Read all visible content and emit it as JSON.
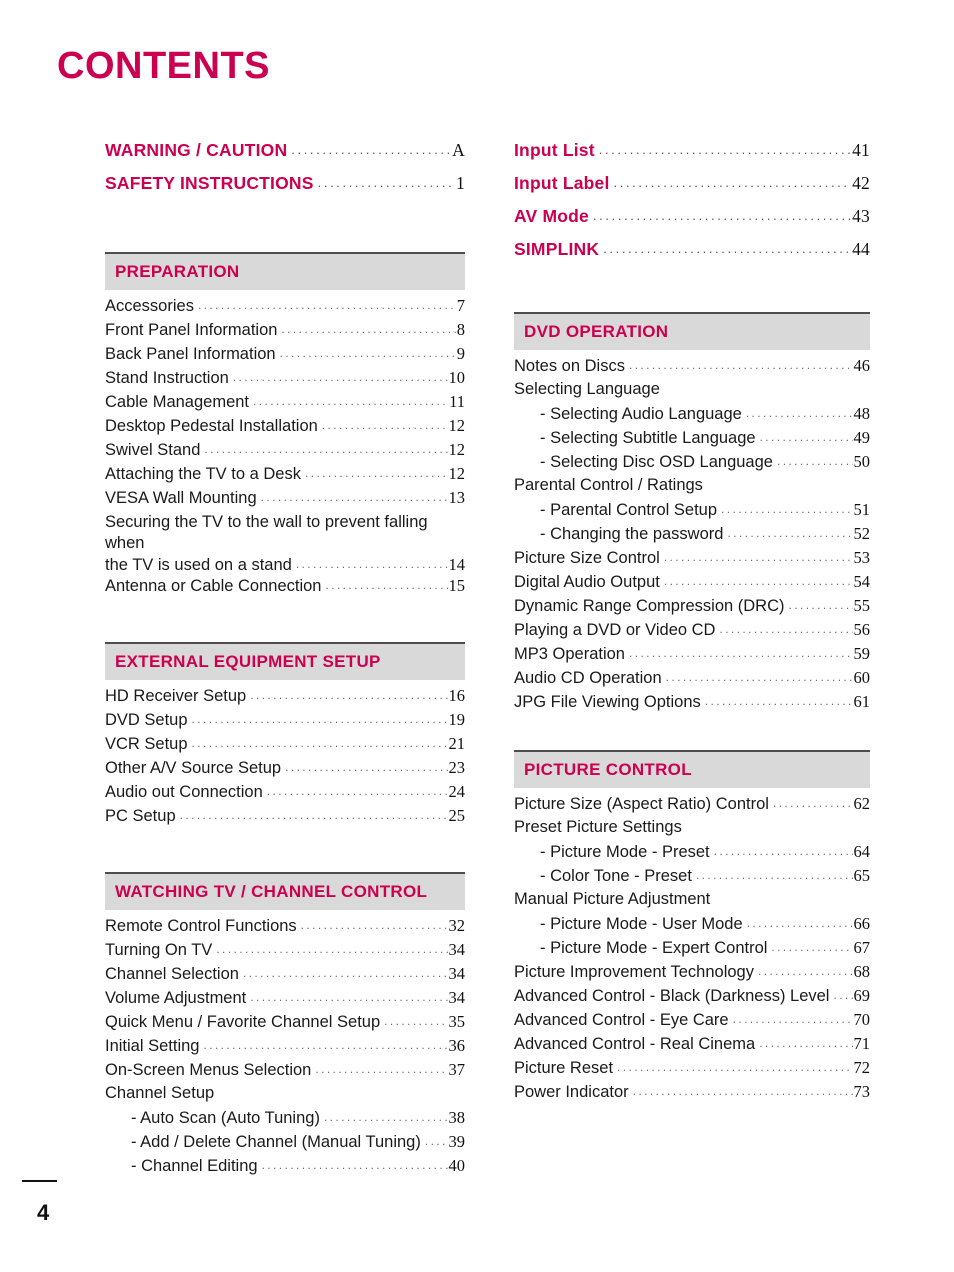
{
  "page": {
    "title": "CONTENTS",
    "page_number": "4",
    "accent_color": "#cc0050",
    "band_color": "#d9d9d9",
    "rule_color": "#4d4d4d"
  },
  "left_column": {
    "top_entries": [
      {
        "label": "WARNING / CAUTION",
        "page": "A"
      },
      {
        "label": "SAFETY INSTRUCTIONS",
        "page": "1"
      }
    ],
    "sections": [
      {
        "title": "PREPARATION",
        "entries": [
          {
            "label": "Accessories",
            "page": "7"
          },
          {
            "label": "Front Panel Information",
            "page": "8"
          },
          {
            "label": "Back Panel Information",
            "page": "9"
          },
          {
            "label": "Stand Instruction",
            "page": "10"
          },
          {
            "label": "Cable Management",
            "page": "11"
          },
          {
            "label": "Desktop Pedestal Installation",
            "page": "12"
          },
          {
            "label": "Swivel Stand",
            "page": "12"
          },
          {
            "label": "Attaching the TV to a Desk",
            "page": "12"
          },
          {
            "label": "VESA Wall Mounting",
            "page": "13"
          },
          {
            "label": "Securing the TV to the wall to prevent falling when",
            "label2": "the TV is used on a stand",
            "page": "14",
            "wrap": true
          },
          {
            "label": "Antenna or Cable Connection",
            "page": "15"
          }
        ]
      },
      {
        "title": "EXTERNAL EQUIPMENT SETUP",
        "entries": [
          {
            "label": "HD Receiver Setup",
            "page": "16"
          },
          {
            "label": "DVD Setup",
            "page": "19"
          },
          {
            "label": "VCR Setup",
            "page": "21"
          },
          {
            "label": "Other A/V Source Setup",
            "page": "23"
          },
          {
            "label": "Audio out Connection",
            "page": "24"
          },
          {
            "label": "PC Setup",
            "page": "25"
          }
        ]
      },
      {
        "title": "WATCHING TV / CHANNEL CONTROL",
        "entries": [
          {
            "label": "Remote Control Functions",
            "page": "32"
          },
          {
            "label": "Turning On TV",
            "page": "34"
          },
          {
            "label": "Channel Selection",
            "page": "34"
          },
          {
            "label": "Volume Adjustment",
            "page": "34"
          },
          {
            "label": "Quick Menu / Favorite Channel Setup",
            "page": "35"
          },
          {
            "label": "Initial Setting",
            "page": "36"
          },
          {
            "label": "On-Screen Menus Selection",
            "page": "37"
          },
          {
            "label": "Channel Setup",
            "page": ""
          },
          {
            "label": "- Auto Scan (Auto Tuning)",
            "page": "38",
            "sub": true
          },
          {
            "label": "- Add / Delete Channel (Manual Tuning)",
            "page": "39",
            "sub": true
          },
          {
            "label": "- Channel Editing",
            "page": "40",
            "sub": true
          }
        ]
      }
    ]
  },
  "right_column": {
    "top_entries": [
      {
        "label": "Input List",
        "page": "41"
      },
      {
        "label": "Input Label",
        "page": "42"
      },
      {
        "label": "AV Mode",
        "page": "43"
      },
      {
        "label": "SIMPLINK",
        "page": "44"
      }
    ],
    "sections": [
      {
        "title": "DVD OPERATION",
        "entries": [
          {
            "label": "Notes on Discs",
            "page": "46"
          },
          {
            "label": "Selecting Language",
            "page": ""
          },
          {
            "label": "- Selecting Audio Language",
            "page": "48",
            "sub": true
          },
          {
            "label": "- Selecting Subtitle Language",
            "page": "49",
            "sub": true
          },
          {
            "label": "- Selecting Disc OSD Language",
            "page": "50",
            "sub": true
          },
          {
            "label": "Parental Control / Ratings",
            "page": ""
          },
          {
            "label": "- Parental Control Setup",
            "page": "51",
            "sub": true
          },
          {
            "label": "- Changing the password",
            "page": "52",
            "sub": true
          },
          {
            "label": "Picture Size Control",
            "page": "53"
          },
          {
            "label": "Digital Audio Output",
            "page": "54"
          },
          {
            "label": "Dynamic Range Compression (DRC)",
            "page": "55"
          },
          {
            "label": "Playing a DVD or Video CD",
            "page": "56"
          },
          {
            "label": "MP3 Operation",
            "page": "59"
          },
          {
            "label": "Audio CD Operation",
            "page": "60"
          },
          {
            "label": "JPG File Viewing Options",
            "page": "61"
          }
        ]
      },
      {
        "title": "PICTURE CONTROL",
        "entries": [
          {
            "label": "Picture Size (Aspect Ratio) Control",
            "page": "62"
          },
          {
            "label": "Preset Picture Settings",
            "page": ""
          },
          {
            "label": "- Picture Mode - Preset",
            "page": "64",
            "sub": true
          },
          {
            "label": "- Color Tone - Preset",
            "page": "65",
            "sub": true
          },
          {
            "label": "Manual Picture Adjustment",
            "page": ""
          },
          {
            "label": "- Picture Mode - User Mode",
            "page": "66",
            "sub": true
          },
          {
            "label": "- Picture Mode - Expert Control",
            "page": "67",
            "sub": true
          },
          {
            "label": "Picture Improvement Technology",
            "page": "68"
          },
          {
            "label": "Advanced Control - Black (Darkness) Level",
            "page": "69"
          },
          {
            "label": "Advanced Control - Eye Care",
            "page": "70"
          },
          {
            "label": "Advanced Control - Real Cinema",
            "page": "71"
          },
          {
            "label": "Picture Reset",
            "page": "72"
          },
          {
            "label": "Power Indicator",
            "page": "73"
          }
        ]
      }
    ]
  }
}
